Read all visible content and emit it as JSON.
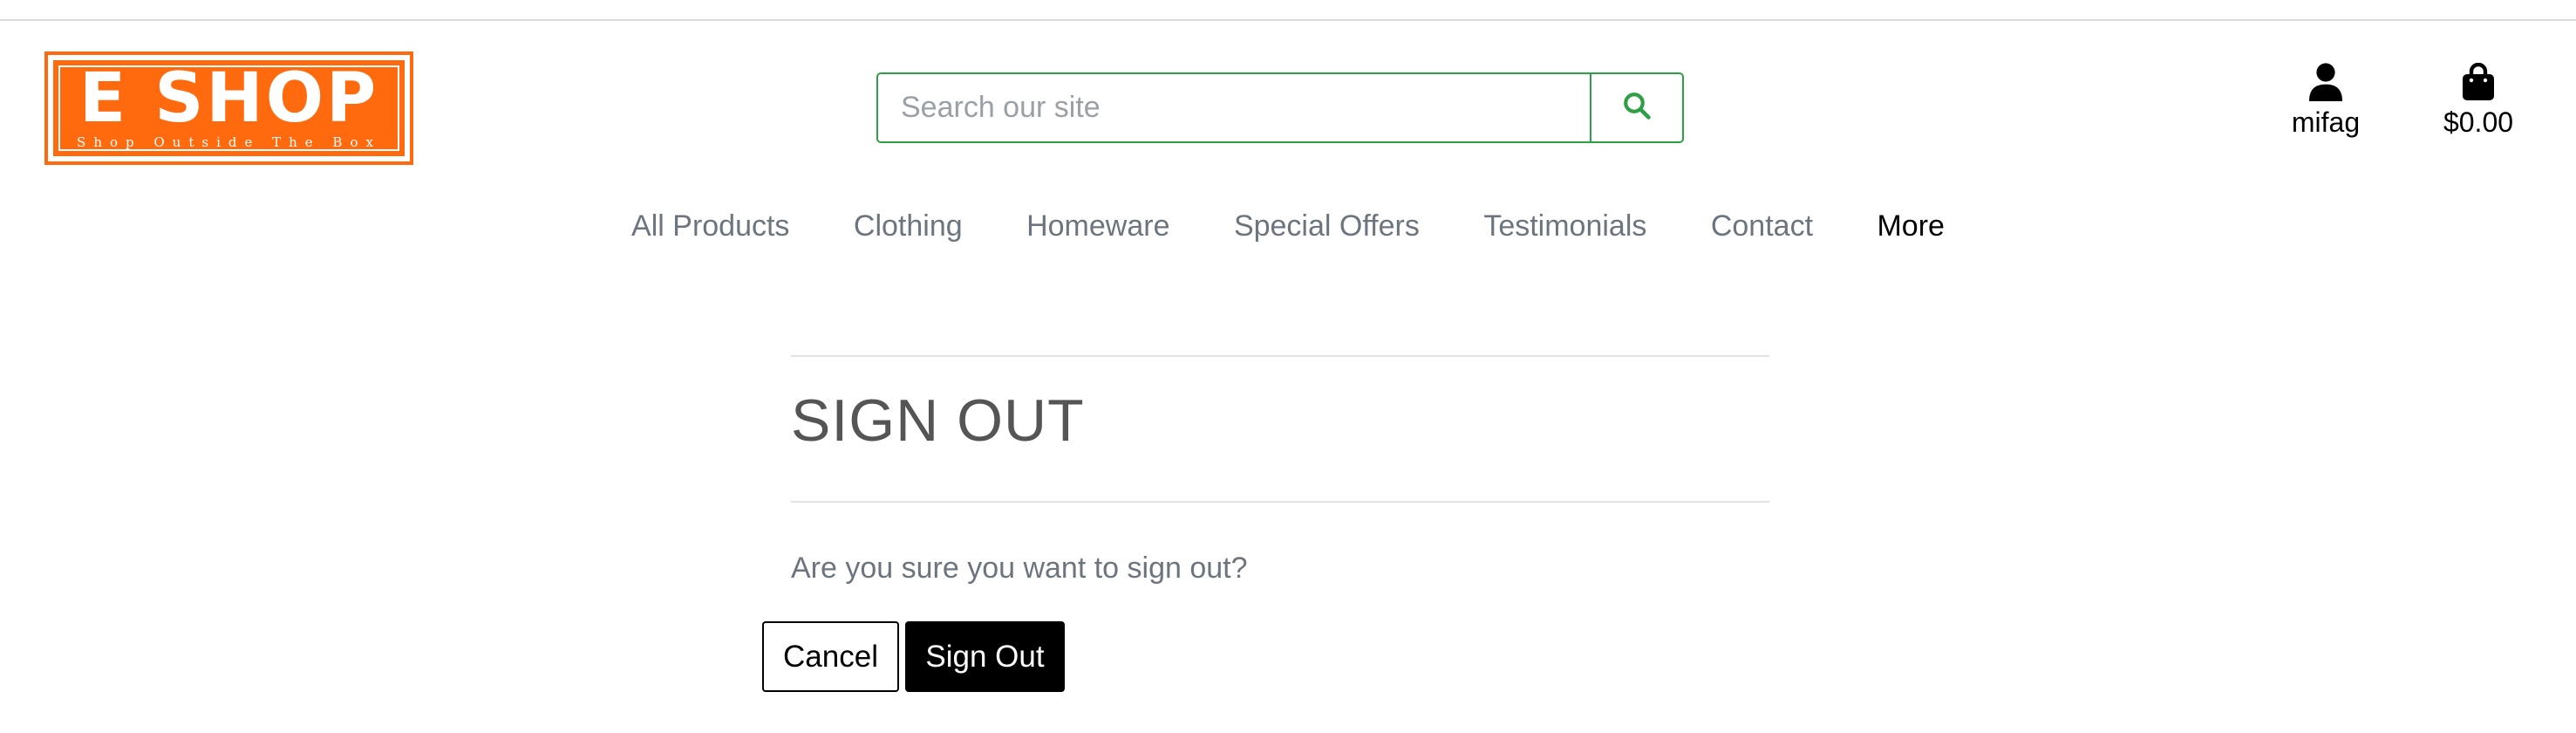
{
  "logo": {
    "title": "E SHOP",
    "tagline": "Shop Outside The Box",
    "brand_color": "#ff6a0f"
  },
  "search": {
    "placeholder": "Search our site",
    "value": "",
    "icon": "search-icon",
    "accent_color": "#2e9f44"
  },
  "account": {
    "icon": "user-icon",
    "username": "mifag"
  },
  "bag": {
    "icon": "shopping-bag-icon",
    "total": "$0.00"
  },
  "nav": {
    "items": [
      {
        "label": "All Products"
      },
      {
        "label": "Clothing"
      },
      {
        "label": "Homeware"
      },
      {
        "label": "Special Offers"
      },
      {
        "label": "Testimonials"
      },
      {
        "label": "Contact"
      },
      {
        "label": "More"
      }
    ]
  },
  "main": {
    "title": "SIGN OUT",
    "prompt": "Are you sure you want to sign out?",
    "cancel_label": "Cancel",
    "signout_label": "Sign Out"
  }
}
